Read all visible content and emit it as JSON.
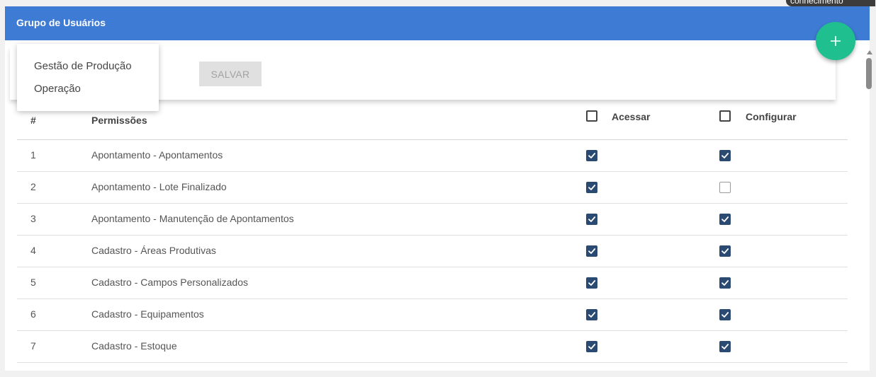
{
  "tooltip": {
    "text": "conhecimento"
  },
  "card": {
    "title": "Grupo de Usuários"
  },
  "fab": {
    "icon": "plus-icon"
  },
  "toolbar": {
    "save_label": "SALVAR"
  },
  "dropdown": {
    "items": [
      {
        "label": "Gestão de Produção"
      },
      {
        "label": "Operação"
      }
    ]
  },
  "table": {
    "headers": {
      "index": "#",
      "permission": "Permissões",
      "access": "Acessar",
      "configure": "Configurar"
    },
    "header_access_checked": false,
    "header_configure_checked": false,
    "rows": [
      {
        "index": "1",
        "permission": "Apontamento - Apontamentos",
        "access": true,
        "configure": true
      },
      {
        "index": "2",
        "permission": "Apontamento - Lote Finalizado",
        "access": true,
        "configure": false
      },
      {
        "index": "3",
        "permission": "Apontamento - Manutenção de Apontamentos",
        "access": true,
        "configure": true
      },
      {
        "index": "4",
        "permission": "Cadastro - Áreas Produtivas",
        "access": true,
        "configure": true
      },
      {
        "index": "5",
        "permission": "Cadastro - Campos Personalizados",
        "access": true,
        "configure": true
      },
      {
        "index": "6",
        "permission": "Cadastro - Equipamentos",
        "access": true,
        "configure": true
      },
      {
        "index": "7",
        "permission": "Cadastro - Estoque",
        "access": true,
        "configure": true
      }
    ]
  },
  "colors": {
    "header": "#3e7bd4",
    "fab": "#1fbf8f",
    "checkbox": "#2b4a72"
  }
}
